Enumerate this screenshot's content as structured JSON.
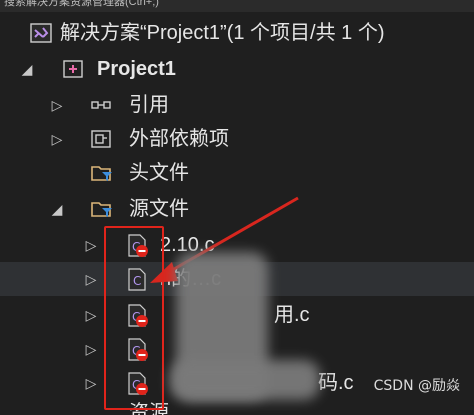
{
  "top_bar": {
    "text": "搜索解决方案资源管理器(Ctrl+;)"
  },
  "solution": {
    "label": "解决方案“Project1”(1 个项目/共 1 个)"
  },
  "project": {
    "label": "Project1"
  },
  "nodes": {
    "references": "引用",
    "external_deps": "外部依赖项",
    "header_files": "头文件",
    "source_files": "源文件"
  },
  "files": [
    {
      "label": "2.10.c"
    },
    {
      "label": "n的…c"
    },
    {
      "label": "用.c"
    },
    {
      "label": ""
    },
    {
      "label": "码.c"
    }
  ],
  "bottom_partial": {
    "label": "资源"
  },
  "watermark": "CSDN @励焱",
  "colors": {
    "accent_red": "#e0241b",
    "arrow_red": "#d8261e",
    "folder_yellow": "#dcb67a",
    "cs_purple": "#7b5fc7"
  }
}
